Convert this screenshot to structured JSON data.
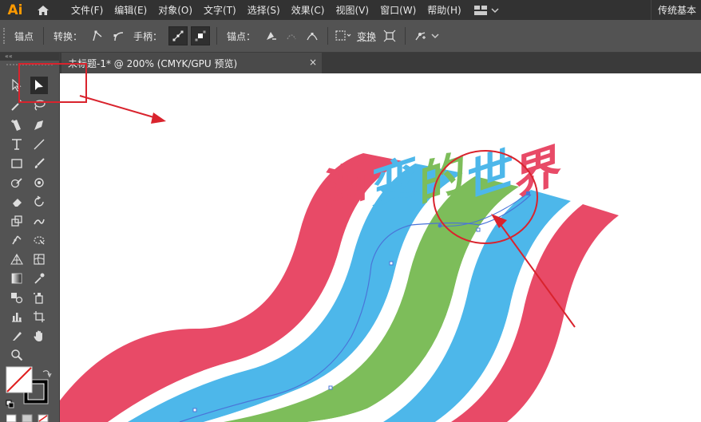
{
  "app": {
    "logo": "Ai",
    "workspace": "传统基本"
  },
  "menu": [
    "文件(F)",
    "编辑(E)",
    "对象(O)",
    "文字(T)",
    "选择(S)",
    "效果(C)",
    "视图(V)",
    "窗口(W)",
    "帮助(H)"
  ],
  "control": {
    "mode": "锚点",
    "convert": "转换：",
    "handles": "手柄：",
    "anchors": "锚点：",
    "transform": "变换"
  },
  "document": {
    "tab_title": "未标题-1* @ 200% (CMYK/GPU 预览)",
    "close": "×"
  },
  "toolbar": {
    "collapse": "««"
  },
  "artwork": {
    "colors": {
      "red": "#e84a67",
      "blue": "#4db7ea",
      "green": "#7dbd5a",
      "annotation": "#d9232d"
    },
    "title_chars": [
      "渐",
      "变",
      "的",
      "世",
      "界"
    ]
  }
}
